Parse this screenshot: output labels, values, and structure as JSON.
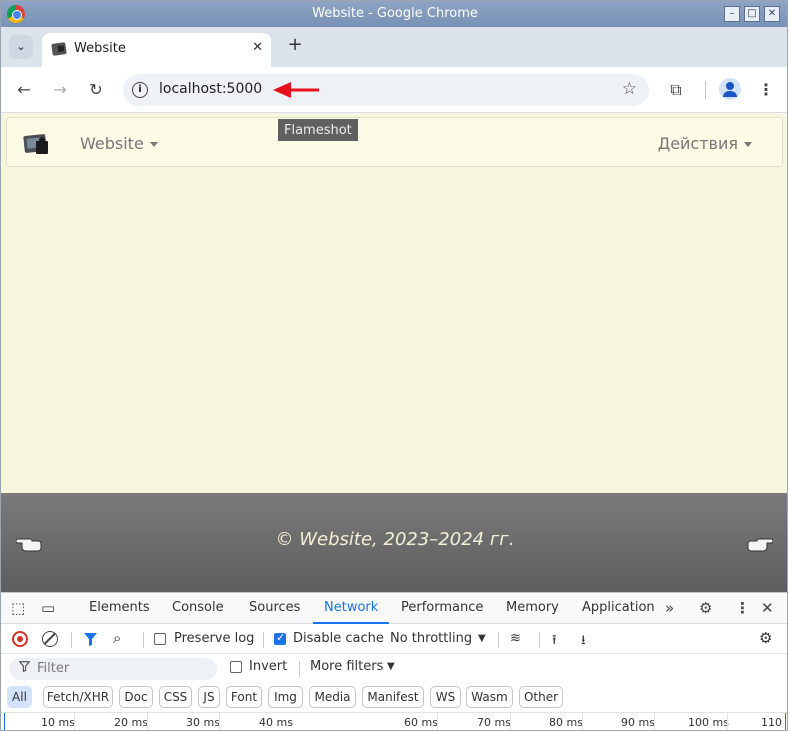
{
  "window": {
    "title": "Website - Google Chrome",
    "min": "–",
    "max": "□",
    "close": "✕"
  },
  "tabstrip": {
    "tab_title": "Website",
    "tab_close": "✕",
    "new_tab": "+",
    "list_tabs": "⌄"
  },
  "toolbar": {
    "back": "←",
    "forward": "→",
    "reload": "↻",
    "url": "localhost:5000",
    "info": "i",
    "bookmark": "☆",
    "extensions": "⧉",
    "menu": "⋮"
  },
  "page": {
    "navbar": {
      "brand_menu": "Website",
      "actions_menu": "Действия"
    },
    "footer": {
      "copyright": "© Website, 2023–2024 гг."
    }
  },
  "devtools": {
    "tabs": [
      "Elements",
      "Console",
      "Sources",
      "Network",
      "Performance",
      "Memory",
      "Application"
    ],
    "more_tabs": "»",
    "toolbar": {
      "preserve_log": "Preserve log",
      "preserve_log_checked": false,
      "disable_cache": "Disable cache",
      "disable_cache_checked": true,
      "throttling": "No throttling"
    },
    "filter": {
      "placeholder": "Filter",
      "invert": "Invert",
      "more_filters": "More filters"
    },
    "type_filters": [
      "All",
      "Fetch/XHR",
      "Doc",
      "CSS",
      "JS",
      "Font",
      "Img",
      "Media",
      "Manifest",
      "WS",
      "Wasm",
      "Other"
    ],
    "timeline_ticks": [
      "10 ms",
      "20 ms",
      "30 ms",
      "40 ms",
      "60 ms",
      "70 ms",
      "80 ms",
      "90 ms",
      "100 ms",
      "110"
    ]
  },
  "overlay": {
    "tooltip": "Flameshot"
  },
  "colors": {
    "accent": "#1a73e8",
    "page_bg": "#f6f6dc",
    "footer_bg": "#6b6b6b",
    "record": "#d93025",
    "arrow": "#e8101a"
  }
}
